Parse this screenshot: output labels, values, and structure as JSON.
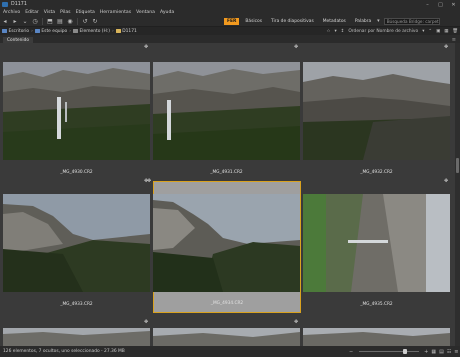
{
  "window": {
    "title": "D1171"
  },
  "menu": [
    "Archivo",
    "Editar",
    "Vista",
    "Pilas",
    "Etiqueta",
    "Herramientas",
    "Ventana",
    "Ayuda"
  ],
  "workspaces": {
    "active": "FER",
    "items": [
      "Básicos",
      "Tira de diapositivas",
      "Metadatos",
      "Palabra"
    ],
    "search_placeholder": "Búsqueda Bridge: carpeta ..."
  },
  "breadcrumb": [
    {
      "label": "Escritorio"
    },
    {
      "label": "Este equipo"
    },
    {
      "label": "Elemento (H:)"
    },
    {
      "label": "D1171"
    }
  ],
  "sort": {
    "label": "Ordenar por Nombre de archivo"
  },
  "panel_tab": "Contenido",
  "thumbnails": [
    {
      "filename": "_MG_4930.CR2",
      "selected": false
    },
    {
      "filename": "_MG_4931.CR2",
      "selected": false
    },
    {
      "filename": "_MG_4932.CR2",
      "selected": false
    },
    {
      "filename": "_MG_4933.CR2",
      "selected": false
    },
    {
      "filename": "_MG_4934.CR2",
      "selected": true
    },
    {
      "filename": "_MG_4935.CR2",
      "selected": false
    }
  ],
  "status": {
    "text": "126 elementos, 7 ocultos, uno seleccionado - 27.36 MB"
  },
  "zoom": {
    "value": 0.8
  },
  "colors": {
    "accent": "#f29a1f",
    "selection_border": "#d9a21f"
  }
}
